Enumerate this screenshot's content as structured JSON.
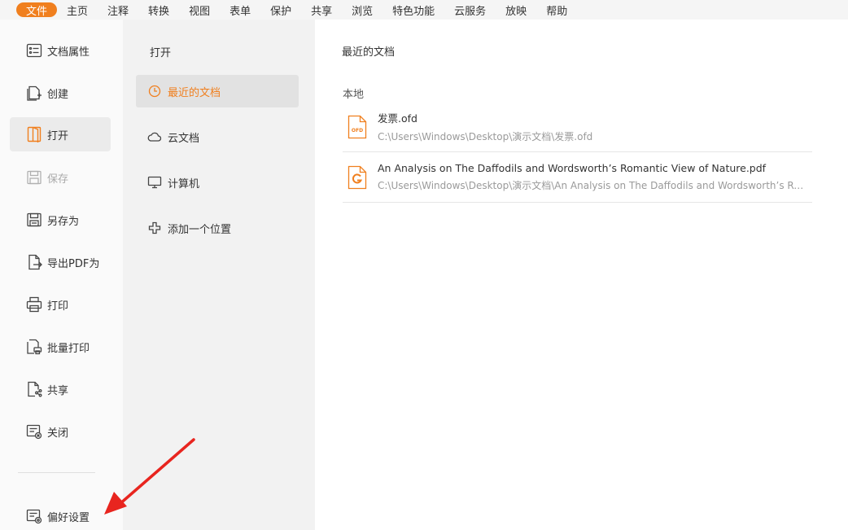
{
  "menu": [
    {
      "label": "文件",
      "active": true
    },
    {
      "label": "主页"
    },
    {
      "label": "注释"
    },
    {
      "label": "转换"
    },
    {
      "label": "视图"
    },
    {
      "label": "表单"
    },
    {
      "label": "保护"
    },
    {
      "label": "共享"
    },
    {
      "label": "浏览"
    },
    {
      "label": "特色功能"
    },
    {
      "label": "云服务"
    },
    {
      "label": "放映"
    },
    {
      "label": "帮助"
    }
  ],
  "sidebar": {
    "items": [
      {
        "label": "文档属性",
        "icon": "properties-icon"
      },
      {
        "label": "创建",
        "icon": "create-icon"
      },
      {
        "label": "打开",
        "icon": "open-icon",
        "active": true
      },
      {
        "label": "保存",
        "icon": "save-icon",
        "disabled": true
      },
      {
        "label": "另存为",
        "icon": "save-as-icon"
      },
      {
        "label": "导出PDF为",
        "icon": "export-pdf-icon"
      },
      {
        "label": "打印",
        "icon": "print-icon"
      },
      {
        "label": "批量打印",
        "icon": "batch-print-icon"
      },
      {
        "label": "共享",
        "icon": "share-icon"
      },
      {
        "label": "关闭",
        "icon": "close-doc-icon"
      }
    ],
    "preferences": {
      "label": "偏好设置",
      "icon": "preferences-icon"
    }
  },
  "middle": {
    "title": "打开",
    "items": [
      {
        "label": "最近的文档",
        "icon": "clock-icon",
        "active": true
      },
      {
        "label": "云文档",
        "icon": "cloud-icon"
      },
      {
        "label": "计算机",
        "icon": "computer-icon"
      },
      {
        "label": "添加一个位置",
        "icon": "plus-icon"
      }
    ]
  },
  "content": {
    "title": "最近的文档",
    "section": "本地",
    "files": [
      {
        "name": "发票.ofd",
        "path": "C:\\Users\\Windows\\Desktop\\演示文档\\发票.ofd",
        "icon": "ofd-file-icon",
        "icon_text": "OFD"
      },
      {
        "name": "An Analysis on The Daffodils and Wordsworth’s Romantic View of Nature.pdf",
        "path": "C:\\Users\\Windows\\Desktop\\演示文档\\An Analysis on The Daffodils and Wordsworth’s Romantic View of Nature.pdf",
        "icon": "pdf-file-icon"
      }
    ]
  },
  "colors": {
    "accent": "#f07f1e",
    "annotation": "#e8251f"
  }
}
